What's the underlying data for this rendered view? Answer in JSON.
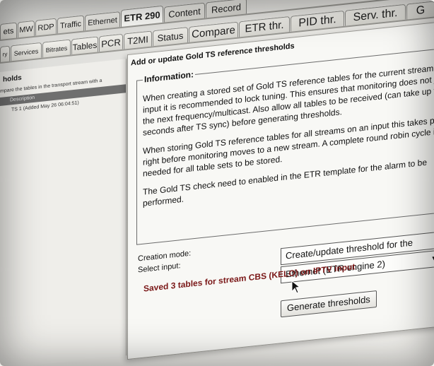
{
  "tabs_row1": [
    "ets",
    "MW",
    "RDP",
    "Traffic",
    "Ethernet",
    "ETR 290",
    "Content",
    "Record"
  ],
  "tabs_row2": [
    "ry",
    "Services",
    "Bitrates",
    "Tables",
    "PCR",
    "T2MI",
    "Status",
    "Compare",
    "ETR thr.",
    "PID thr.",
    "Serv. thr.",
    "G"
  ],
  "active_tab_row1": "ETR 290",
  "left_panel": {
    "title": "holds",
    "description": "mpare the tables in the transport stream with a",
    "column_header": "Description",
    "item": "TS 1 (Added May 26 06:04:51)"
  },
  "dialog": {
    "title": "Add or update Gold TS reference thresholds",
    "info_legend": "Information:",
    "paragraph1": "When creating a stored set of Gold TS reference tables for the current stream on an input it is recommended to lock tuning. This ensures that monitoring does not jump to the next frequency/multicast. Also allow all tables to be received (can take up to 30 seconds after TS sync) before generating thresholds.",
    "paragraph2": "When storing Gold TS reference tables for all streams on an input this takes place right before monitoring moves to a new stream. A complete round robin cycle is needed for all table sets to be stored.",
    "paragraph3": "The Gold TS check need to enabled in the ETR template for the alarm to be performed.",
    "creation_mode_label": "Creation mode:",
    "select_input_label": "Select input:",
    "creation_mode_value": "Create/update threshold for the",
    "select_input_value": "Ethernet (ETR engine 2)",
    "status_message": "Saved 3 tables for stream CBS (KELO) on IPTV input",
    "generate_button": "Generate thresholds"
  },
  "colors": {
    "status_text": "#7a1717",
    "header_bar": "#6f6f6f"
  }
}
